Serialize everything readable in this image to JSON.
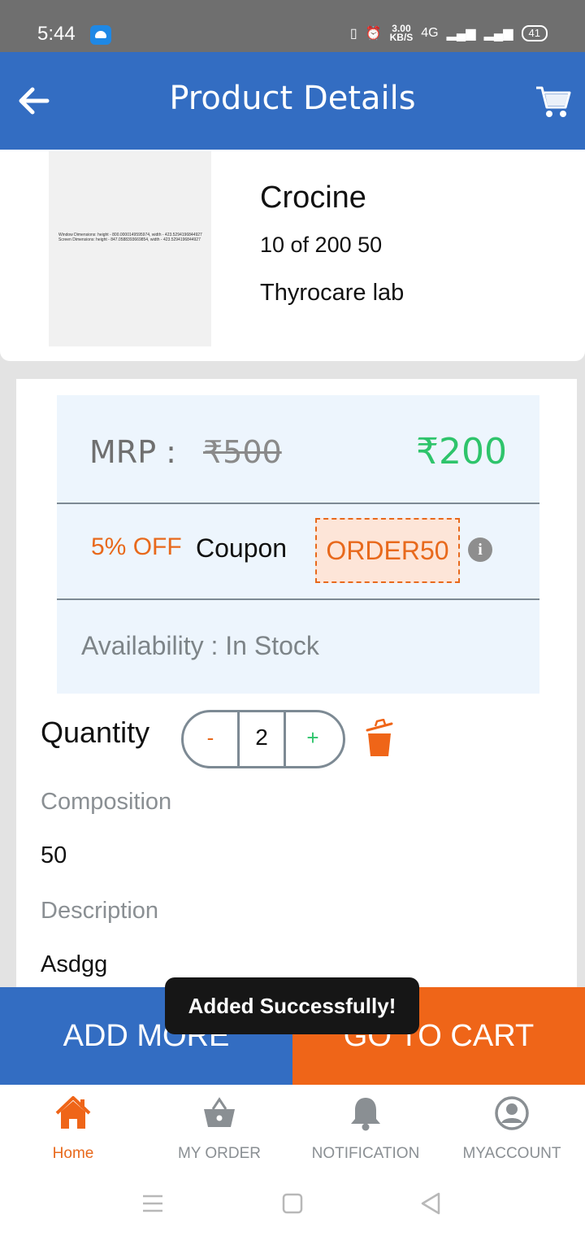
{
  "status_bar": {
    "time": "5:44",
    "speed_value": "3.00",
    "speed_unit": "KB/S",
    "network": "4G",
    "battery": "41"
  },
  "header": {
    "title": "Product Details",
    "back_icon": "arrow-left-icon",
    "cart_icon": "cart-icon"
  },
  "product": {
    "name": "Crocine",
    "subtitle": "10 of 200 50",
    "lab": "Thyrocare lab",
    "image_text": "Window Dimensions: height - 800.0000149595974, width - 423.5294196844927 Screen Dimensions: height - 847.0588393669854, width - 423.5294196844927"
  },
  "pricing": {
    "mrp_label": "MRP :",
    "mrp_old": "₹500",
    "price": "₹200",
    "discount": "5% OFF",
    "coupon_label": "Coupon",
    "coupon_code": "ORDER50",
    "availability": "Availability : In Stock"
  },
  "quantity": {
    "label": "Quantity",
    "minus": "-",
    "value": "2",
    "plus": "+"
  },
  "details": {
    "composition_label": "Composition",
    "composition_value": "50",
    "description_label": "Description",
    "description_value": "Asdgg"
  },
  "actions": {
    "add_more": "ADD MORE",
    "go_to_cart": "GO TO CART"
  },
  "toast": {
    "message": "Added Successfully!"
  },
  "bottom_nav": [
    {
      "label": "Home",
      "icon": "home-icon",
      "active": true
    },
    {
      "label": "MY ORDER",
      "icon": "basket-icon",
      "active": false
    },
    {
      "label": "NOTIFICATION",
      "icon": "bell-icon",
      "active": false
    },
    {
      "label": "MYACCOUNT",
      "icon": "account-icon",
      "active": false
    }
  ],
  "colors": {
    "primary_blue": "#336dc2",
    "accent_orange": "#ef6518",
    "price_green": "#2ec46b",
    "price_box_bg": "#edf5fd"
  }
}
